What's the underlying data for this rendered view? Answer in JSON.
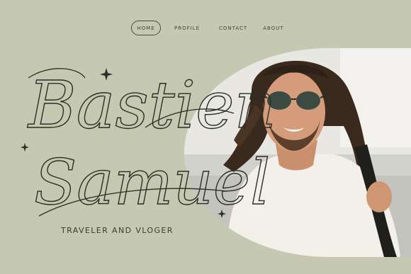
{
  "nav": {
    "items": [
      {
        "label": "HOME",
        "active": true
      },
      {
        "label": "PROFILE"
      },
      {
        "label": "CONTACT"
      },
      {
        "label": "ABOUT"
      }
    ]
  },
  "hero": {
    "first_name": "Bastien",
    "last_name": "Samuel",
    "tagline": "TRAVELER AND VLOGER"
  },
  "colors": {
    "background": "#c6c9b1",
    "ink": "#2c2d26"
  },
  "icons": [
    "sparkle-icon",
    "sparkle-icon",
    "sparkle-icon"
  ]
}
